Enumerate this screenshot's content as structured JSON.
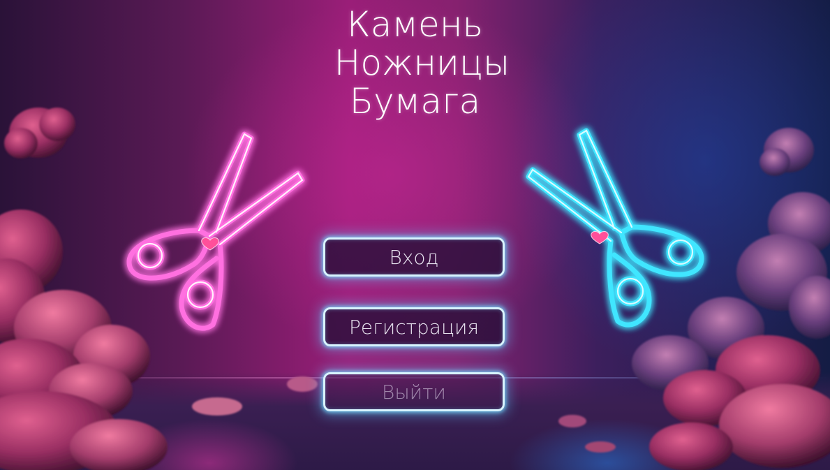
{
  "title": {
    "line1": "Камень",
    "line2": "Ножницы",
    "line3": "Бумага"
  },
  "menu": {
    "login_label": "Вход",
    "register_label": "Регистрация",
    "exit_label": "Выйти"
  },
  "colors": {
    "neon_pink": "#ff4fd8",
    "neon_cyan": "#3fe6ff",
    "heart": "#ff4f9a",
    "button_border": "#d8f4ff",
    "button_fill": "#2a103a"
  },
  "decorations": {
    "left_icon": "scissors-icon",
    "right_icon": "scissors-icon",
    "heart_icon": "heart-icon"
  }
}
